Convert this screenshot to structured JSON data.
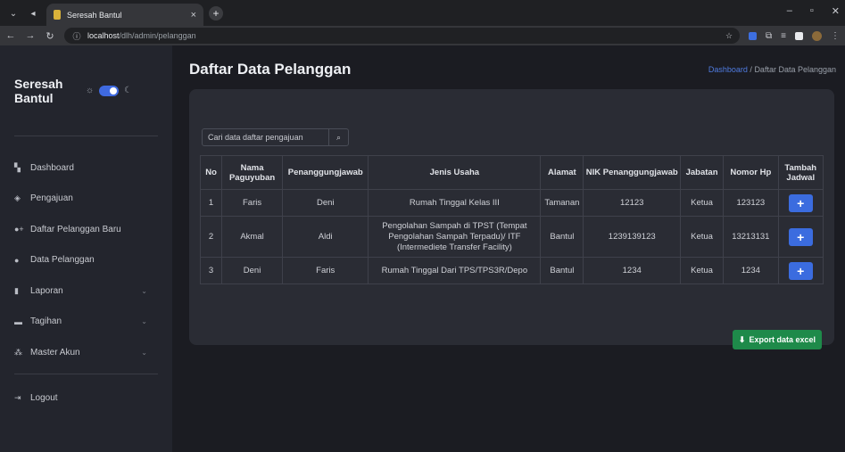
{
  "browser": {
    "tab_title": "Seresah Bantul",
    "url_host": "localhost",
    "url_path": "/dlh/admin/pelanggan"
  },
  "sidebar": {
    "brand": "Seresah Bantul",
    "items": [
      {
        "label": "Dashboard",
        "icon": "grid-icon"
      },
      {
        "label": "Pengajuan",
        "icon": "layers-icon"
      },
      {
        "label": "Daftar Pelanggan Baru",
        "icon": "user-plus-icon"
      },
      {
        "label": "Data Pelanggan",
        "icon": "user-icon"
      },
      {
        "label": "Laporan",
        "icon": "file-icon",
        "has_submenu": true
      },
      {
        "label": "Tagihan",
        "icon": "credit-card-icon",
        "has_submenu": true
      },
      {
        "label": "Master Akun",
        "icon": "users-icon",
        "has_submenu": true
      }
    ],
    "logout": "Logout"
  },
  "main": {
    "title": "Daftar Data Pelanggan",
    "breadcrumb": {
      "home": "Dashboard",
      "separator": "/",
      "current": "Daftar Data Pelanggan"
    },
    "search_placeholder": "Cari data daftar pengajuan",
    "table": {
      "headers": [
        "No",
        "Nama Paguyuban",
        "Penanggungjawab",
        "Jenis Usaha",
        "Alamat",
        "NIK Penanggungjawab",
        "Jabatan",
        "Nomor Hp",
        "Tambah Jadwal"
      ],
      "rows": [
        [
          "1",
          "Faris",
          "Deni",
          "Rumah Tinggal Kelas III",
          "Tamanan",
          "12123",
          "Ketua",
          "123123"
        ],
        [
          "2",
          "Akmal",
          "Aldi",
          "Pengolahan Sampah di TPST (Tempat Pengolahan Sampah Terpadu)/ ITF (Intermediete Transfer Facility)",
          "Bantul",
          "1239139123",
          "Ketua",
          "13213131"
        ],
        [
          "3",
          "Deni",
          "Faris",
          "Rumah Tinggal Dari TPS/TPS3R/Depo",
          "Bantul",
          "1234",
          "Ketua",
          "1234"
        ]
      ],
      "add_label": "+"
    },
    "export_label": "Export data excel"
  },
  "colors": {
    "accent": "#3b6cdf",
    "export": "#1e8a4a",
    "sidebar_bg": "#23252d",
    "card_bg": "#2a2c34"
  }
}
